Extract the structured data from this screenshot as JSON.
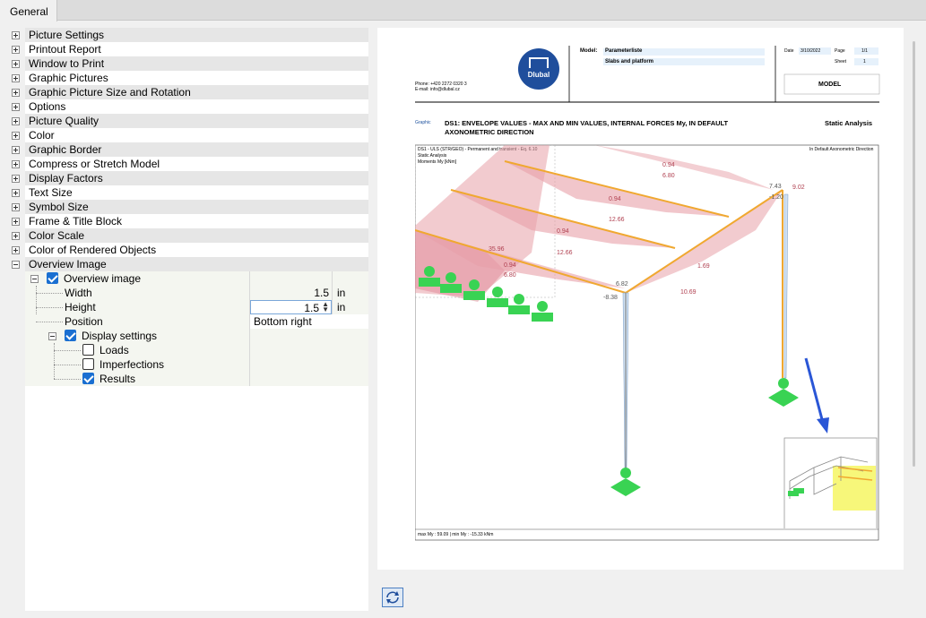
{
  "tabs": [
    {
      "label": "General"
    }
  ],
  "tree": {
    "items": [
      {
        "label": "Picture Settings"
      },
      {
        "label": "Printout Report"
      },
      {
        "label": "Window to Print"
      },
      {
        "label": "Graphic Pictures"
      },
      {
        "label": "Graphic Picture Size and Rotation"
      },
      {
        "label": "Options"
      },
      {
        "label": "Picture Quality"
      },
      {
        "label": "Color"
      },
      {
        "label": "Graphic Border"
      },
      {
        "label": "Compress or Stretch Model"
      },
      {
        "label": "Display Factors"
      },
      {
        "label": "Text Size"
      },
      {
        "label": "Symbol Size"
      },
      {
        "label": "Frame & Title Block"
      },
      {
        "label": "Color Scale"
      },
      {
        "label": "Color of Rendered Objects"
      },
      {
        "label": "Overview Image"
      }
    ],
    "overview": {
      "label": "Overview image",
      "checked": true,
      "width": {
        "label": "Width",
        "value": "1.5",
        "unit": "in"
      },
      "height": {
        "label": "Height",
        "value": "1.5",
        "unit": "in"
      },
      "position": {
        "label": "Position",
        "value": "Bottom right"
      },
      "display_settings": {
        "label": "Display settings",
        "checked": true
      },
      "loads": {
        "label": "Loads",
        "checked": false
      },
      "imperfections": {
        "label": "Imperfections",
        "checked": false
      },
      "results": {
        "label": "Results",
        "checked": true
      }
    }
  },
  "preview": {
    "company": {
      "logo_text": "Dlubal",
      "phone": "Phone: +420 2272 0320 3",
      "email": "E-mail: info@dlubal.cz"
    },
    "model_label": "Model:",
    "model_value": "Parameterliste",
    "model_sub": "Slabs and platform",
    "date_label": "Date",
    "date_value": "3/10/2022",
    "page_label": "Page",
    "page_value": "1/1",
    "sheet_label": "Sheet",
    "sheet_value": "1",
    "section": "MODEL",
    "graphic_tag": "Graphic",
    "graphic_title_line1": "DS1: ENVELOPE VALUES - MAX AND MIN VALUES, INTERNAL FORCES My, IN DEFAULT",
    "graphic_title_line2": "AXONOMETRIC DIRECTION",
    "analysis": "Static Analysis",
    "info_line1": "DS1 - ULS (STR/GEO) - Permanent and transient - Eq. 6.10",
    "info_line2": "Static Analysis",
    "info_line3": "Moments My [kNm]",
    "direction": "In Default Axonometric Direction",
    "footer": "max My : 59.09 | min My : -15.33 kNm",
    "values": [
      "0.94",
      "6.80",
      "7.43",
      "9.02",
      "-1.20",
      "0.94",
      "12.66",
      "0.94",
      "12.66",
      "35.96",
      "0.94",
      "6.80",
      "6.82",
      "-8.38",
      "1.69",
      "10.69"
    ]
  },
  "colors": {
    "accent": "#1a6fd1",
    "diagram_fill": "#e8a0a8",
    "beam": "#f0a830",
    "support": "#39d353",
    "arrow": "#2a56d6",
    "overview_highlight": "#f7f77a"
  },
  "icons": {
    "refresh": "refresh-icon"
  }
}
